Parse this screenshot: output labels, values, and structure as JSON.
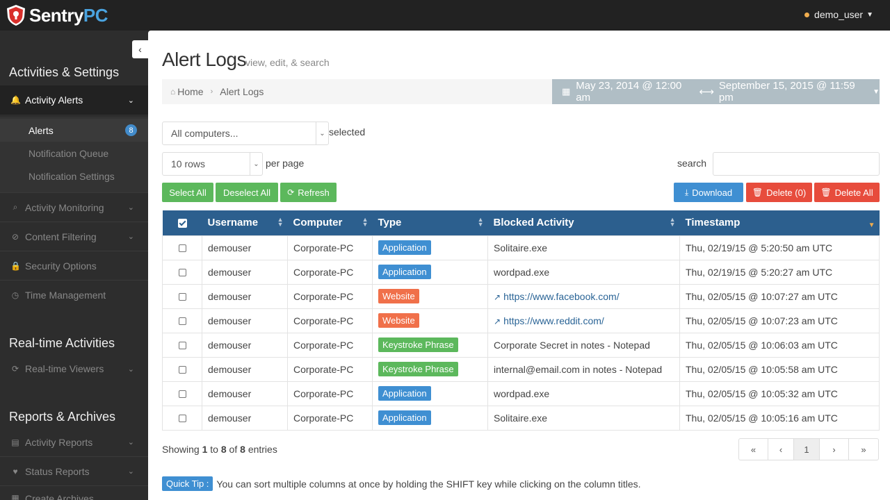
{
  "brand": {
    "name_main": "Sentry",
    "name_accent": "PC"
  },
  "user": {
    "name": "demo_user"
  },
  "sidebar": {
    "sections": {
      "activities": "Activities & Settings",
      "realtime": "Real-time Activities",
      "reports": "Reports & Archives"
    },
    "items": {
      "activity_alerts": "Activity Alerts",
      "activity_monitoring": "Activity Monitoring",
      "content_filtering": "Content Filtering",
      "security_options": "Security Options",
      "time_management": "Time Management",
      "realtime_viewers": "Real-time Viewers",
      "activity_reports": "Activity Reports",
      "status_reports": "Status Reports",
      "create_archives": "Create Archives"
    },
    "sub_items": {
      "alerts": "Alerts",
      "alerts_badge": "8",
      "notification_queue": "Notification Queue",
      "notification_settings": "Notification Settings"
    }
  },
  "page": {
    "title": "Alert Logs",
    "subtitle": "view, edit, & search",
    "breadcrumb": {
      "home": "Home",
      "current": "Alert Logs"
    },
    "date_range": {
      "start": "May 23, 2014 @ 12:00 am",
      "end": "September 15, 2015 @ 11:59 pm"
    }
  },
  "filters": {
    "computers_value": "All computers...",
    "selected_label": "selected",
    "rows_value": "10 rows",
    "per_page_label": "per page",
    "search_label": "search",
    "search_value": ""
  },
  "actions": {
    "select_all": "Select All",
    "deselect_all": "Deselect All",
    "refresh": "Refresh",
    "download": "Download",
    "delete_selected": "Delete (0)",
    "delete_all": "Delete All"
  },
  "table": {
    "headers": {
      "username": "Username",
      "computer": "Computer",
      "type": "Type",
      "blocked": "Blocked Activity",
      "timestamp": "Timestamp"
    },
    "rows": [
      {
        "username": "demouser",
        "computer": "Corporate-PC",
        "type": "Application",
        "blocked": "Solitaire.exe",
        "timestamp": "Thu, 02/19/15 @ 5:20:50 am UTC"
      },
      {
        "username": "demouser",
        "computer": "Corporate-PC",
        "type": "Application",
        "blocked": "wordpad.exe",
        "timestamp": "Thu, 02/19/15 @ 5:20:27 am UTC"
      },
      {
        "username": "demouser",
        "computer": "Corporate-PC",
        "type": "Website",
        "blocked": "https://www.facebook.com/",
        "timestamp": "Thu, 02/05/15 @ 10:07:27 am UTC"
      },
      {
        "username": "demouser",
        "computer": "Corporate-PC",
        "type": "Website",
        "blocked": "https://www.reddit.com/",
        "timestamp": "Thu, 02/05/15 @ 10:07:23 am UTC"
      },
      {
        "username": "demouser",
        "computer": "Corporate-PC",
        "type": "Keystroke Phrase",
        "blocked": "Corporate Secret in notes - Notepad",
        "timestamp": "Thu, 02/05/15 @ 10:06:03 am UTC"
      },
      {
        "username": "demouser",
        "computer": "Corporate-PC",
        "type": "Keystroke Phrase",
        "blocked": "internal@email.com in notes - Notepad",
        "timestamp": "Thu, 02/05/15 @ 10:05:58 am UTC"
      },
      {
        "username": "demouser",
        "computer": "Corporate-PC",
        "type": "Application",
        "blocked": "wordpad.exe",
        "timestamp": "Thu, 02/05/15 @ 10:05:32 am UTC"
      },
      {
        "username": "demouser",
        "computer": "Corporate-PC",
        "type": "Application",
        "blocked": "Solitaire.exe",
        "timestamp": "Thu, 02/05/15 @ 10:05:16 am UTC"
      }
    ]
  },
  "footer": {
    "showing_prefix": "Showing",
    "from": "1",
    "to_word": "to",
    "to": "8",
    "of_word": "of",
    "total": "8",
    "entries_word": "entries",
    "pager": {
      "first": "«",
      "prev": "‹",
      "current": "1",
      "next": "›",
      "last": "»"
    },
    "tip_label": "Quick Tip :",
    "tip_text": "You can sort multiple columns at once by holding the SHIFT key while clicking on the column titles."
  },
  "colors": {
    "primary": "#2c5f8e",
    "green": "#5cb85c",
    "blue": "#3f8fd2",
    "red": "#e74c3c",
    "orange": "#f0704a"
  }
}
